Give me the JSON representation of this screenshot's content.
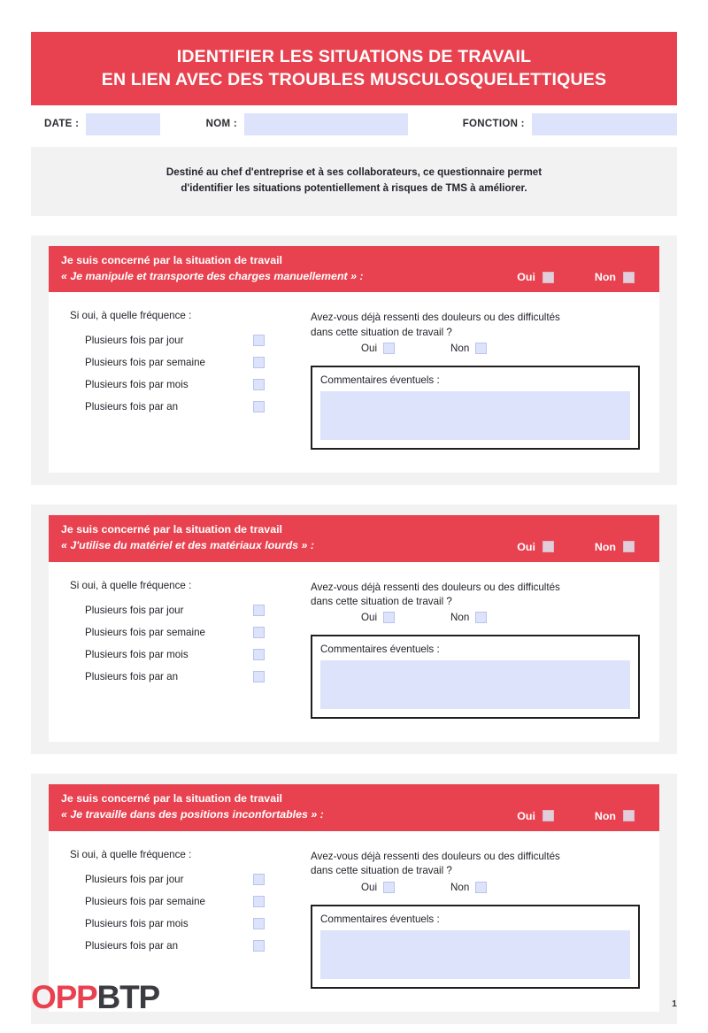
{
  "banner": {
    "line1": "IDENTIFIER LES SITUATIONS DE TRAVAIL",
    "line2": "EN LIEN AVEC DES TROUBLES MUSCULOSQUELETTIQUES"
  },
  "identity": {
    "date_label": "DATE :",
    "date_value": "",
    "nom_label": "NOM :",
    "nom_value": "",
    "fonction_label": "FONCTION :",
    "fonction_value": ""
  },
  "intro": {
    "line1": "Destiné au chef d'entreprise et à ses collaborateurs, ce questionnaire permet",
    "line2": "d'identifier les situations potentiellement à risques de TMS à améliorer."
  },
  "common": {
    "section_intro": "Je suis concerné par la situation de travail",
    "yes_label": "Oui",
    "no_label": "Non",
    "frequency_title": "Si oui, à quelle fréquence :",
    "freq_day": "Plusieurs fois par jour",
    "freq_week": "Plusieurs fois par semaine",
    "freq_month": "Plusieurs fois par mois",
    "freq_year": "Plusieurs fois par an",
    "pain_question_l1": "Avez-vous déjà ressenti des douleurs ou des difficultés",
    "pain_question_l2": "dans cette situation de travail ?",
    "comments_label": "Commentaires éventuels :",
    "comments_value": ""
  },
  "sections": [
    {
      "quote": "« Je manipule et transporte des charges manuellement » :"
    },
    {
      "quote": "« J'utilise du matériel et des matériaux lourds » :"
    },
    {
      "quote": "« Je travaille dans des positions inconfortables » :"
    }
  ],
  "footer": {
    "logo_part1": "OPP",
    "logo_part2": "BTP",
    "page_number": "1"
  },
  "colors": {
    "brand_red": "#e8414f",
    "logo_dark": "#3b3b42",
    "field_blue": "#dde3fa",
    "panel_gray": "#f2f2f2"
  }
}
